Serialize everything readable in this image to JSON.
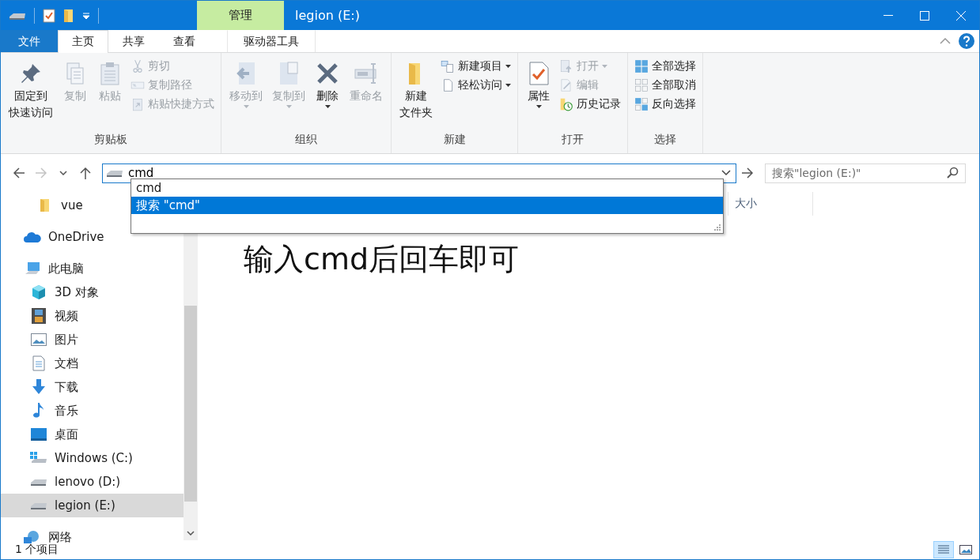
{
  "title_bar": {
    "context_group": "管理",
    "title": "legion (E:)"
  },
  "ribbon_tabs": [
    {
      "label": "文件",
      "kind": "file",
      "selected": false
    },
    {
      "label": "主页",
      "kind": "tab",
      "selected": true
    },
    {
      "label": "共享",
      "kind": "tab",
      "selected": false
    },
    {
      "label": "查看",
      "kind": "tab",
      "selected": false
    },
    {
      "label": "驱动器工具",
      "kind": "context",
      "selected": false
    }
  ],
  "ribbon_groups": [
    {
      "label": "剪贴板",
      "buttons": [
        {
          "label": [
            "固定到",
            "快速访问"
          ],
          "kind": "large",
          "disabled": false,
          "menu": false
        },
        {
          "label": "复制",
          "kind": "large",
          "disabled": true,
          "menu": false
        },
        {
          "label": "粘贴",
          "kind": "large",
          "disabled": true,
          "menu": false
        },
        {
          "label": "剪切",
          "kind": "small",
          "disabled": true,
          "menu": false
        },
        {
          "label": "复制路径",
          "kind": "small",
          "disabled": true,
          "menu": false
        },
        {
          "label": "粘贴快捷方式",
          "kind": "small",
          "disabled": true,
          "menu": false
        }
      ]
    },
    {
      "label": "组织",
      "buttons": [
        {
          "label": "移动到",
          "kind": "large",
          "disabled": true,
          "menu": true
        },
        {
          "label": "复制到",
          "kind": "large",
          "disabled": true,
          "menu": true
        },
        {
          "label": "删除",
          "kind": "large",
          "disabled": false,
          "menu": true
        },
        {
          "label": "重命名",
          "kind": "large",
          "disabled": true,
          "menu": false
        }
      ]
    },
    {
      "label": "新建",
      "buttons": [
        {
          "label": [
            "新建",
            "文件夹"
          ],
          "kind": "large",
          "disabled": false,
          "menu": false
        },
        {
          "label": "新建项目",
          "kind": "small",
          "disabled": false,
          "menu": true
        },
        {
          "label": "轻松访问",
          "kind": "small",
          "disabled": false,
          "menu": true
        }
      ]
    },
    {
      "label": "打开",
      "buttons": [
        {
          "label": "属性",
          "kind": "large",
          "disabled": false,
          "menu": true
        },
        {
          "label": "打开",
          "kind": "small",
          "disabled": true,
          "menu": true
        },
        {
          "label": "编辑",
          "kind": "small",
          "disabled": true,
          "menu": false
        },
        {
          "label": "历史记录",
          "kind": "small",
          "disabled": false,
          "menu": false
        }
      ]
    },
    {
      "label": "选择",
      "buttons": [
        {
          "label": "全部选择",
          "kind": "small",
          "disabled": false,
          "menu": false
        },
        {
          "label": "全部取消",
          "kind": "small",
          "disabled": false,
          "menu": false
        },
        {
          "label": "反向选择",
          "kind": "small",
          "disabled": false,
          "menu": false
        }
      ]
    }
  ],
  "navigation": {
    "back_disabled": false,
    "forward_disabled": true
  },
  "address_bar": {
    "value": "cmd"
  },
  "suggestions": [
    {
      "label": "cmd",
      "selected": false
    },
    {
      "label": "搜索 \"cmd\"",
      "selected": true
    }
  ],
  "search": {
    "placeholder": "搜索\"legion (E:)\""
  },
  "sidebar": {
    "items": [
      {
        "label": "vue",
        "kind": "pinned",
        "selected": false
      },
      {
        "label": "OneDrive",
        "kind": "cloud",
        "selected": false
      },
      {
        "label": "此电脑",
        "kind": "pc",
        "selected": false,
        "children": [
          {
            "label": "3D 对象",
            "kind": "cube",
            "selected": false
          },
          {
            "label": "视频",
            "kind": "video",
            "selected": false
          },
          {
            "label": "图片",
            "kind": "image",
            "selected": false
          },
          {
            "label": "文档",
            "kind": "doc",
            "selected": false
          },
          {
            "label": "下载",
            "kind": "download",
            "selected": false
          },
          {
            "label": "音乐",
            "kind": "music",
            "selected": false
          },
          {
            "label": "桌面",
            "kind": "desktop",
            "selected": false
          },
          {
            "label": "Windows (C:)",
            "kind": "sysdrive",
            "selected": false
          },
          {
            "label": "lenovo (D:)",
            "kind": "drive",
            "selected": false
          },
          {
            "label": "legion (E:)",
            "kind": "drive",
            "selected": true
          }
        ]
      },
      {
        "label": "网络",
        "kind": "network",
        "selected": false
      }
    ]
  },
  "columns": [
    {
      "label": "大小"
    }
  ],
  "annotation": "输入cmd后回车即可",
  "status_bar": {
    "text": "1 个项目",
    "views": [
      {
        "kind": "details",
        "selected": true
      },
      {
        "kind": "large",
        "selected": false
      }
    ]
  }
}
